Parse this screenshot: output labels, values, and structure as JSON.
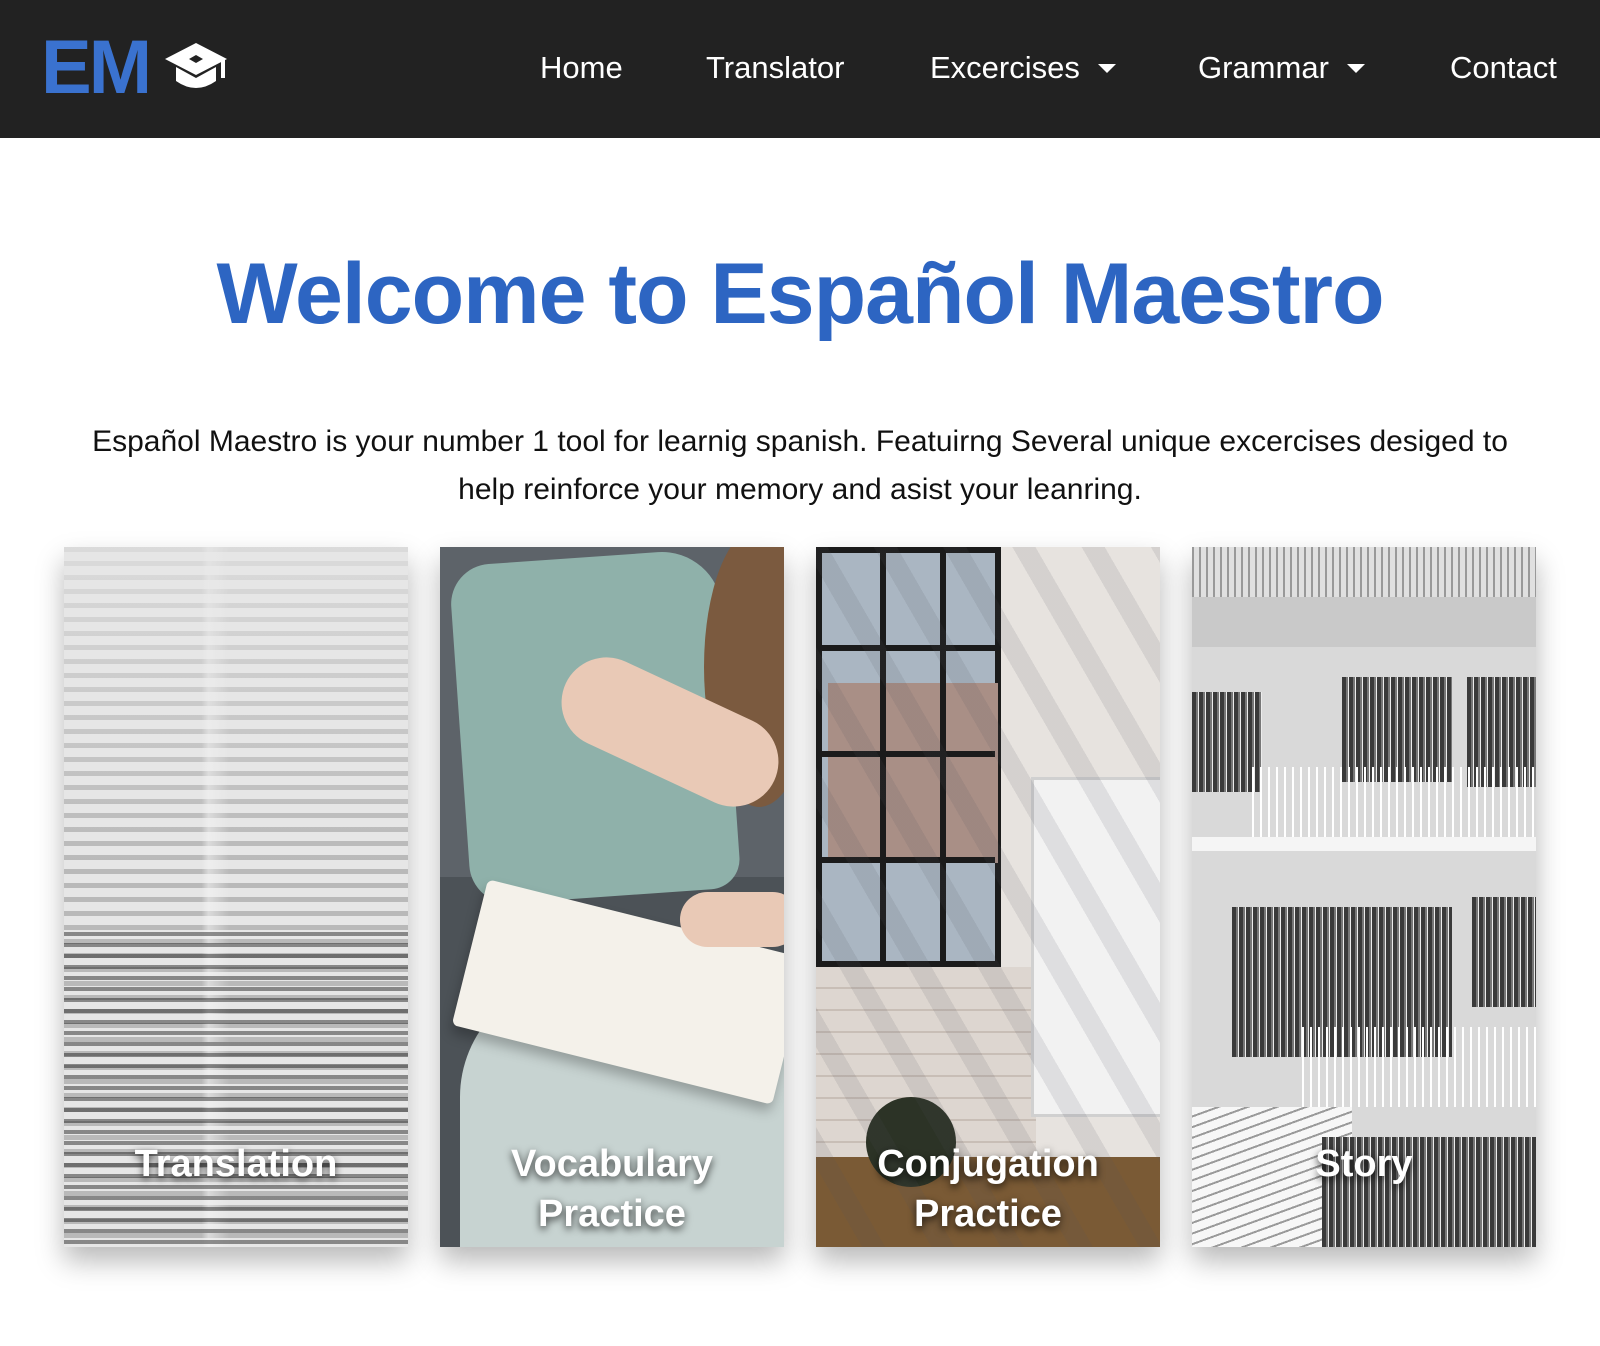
{
  "brand": {
    "text": "EM",
    "icon": "graduation-cap-icon",
    "color": "#3a72cf"
  },
  "nav": {
    "items": [
      {
        "label": "Home"
      },
      {
        "label": "Translator"
      },
      {
        "label": "Excercises",
        "dropdown": true
      },
      {
        "label": "Grammar",
        "dropdown": true
      },
      {
        "label": "Contact"
      }
    ],
    "background": "#222222"
  },
  "hero": {
    "title": "Welcome to Español Maestro",
    "title_color": "#2d65c2",
    "intro_line1": "Español Maestro is your number 1 tool for learnig spanish. Featuirng Several unique excercises desiged to",
    "intro_line2": "help reinforce your memory and asist your leanring."
  },
  "cards": [
    {
      "label_line1": "Translation",
      "label_line2": "",
      "image": "dictionary-page-photo"
    },
    {
      "label_line1": "Vocabulary",
      "label_line2": "Practice",
      "image": "person-reading-book-photo"
    },
    {
      "label_line1": "Conjugation",
      "label_line2": "Practice",
      "image": "room-window-whiteboard-photo"
    },
    {
      "label_line1": "Story",
      "label_line2": "",
      "image": "library-shelves-photo"
    }
  ]
}
